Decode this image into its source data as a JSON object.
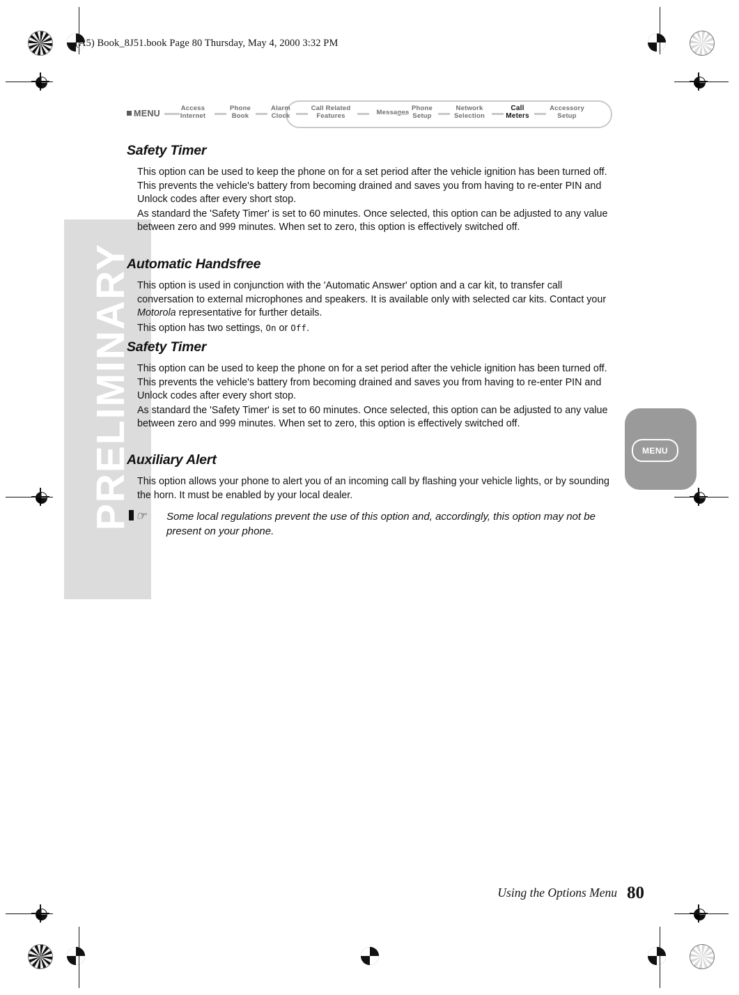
{
  "header": {
    "running_head": "(A5) Book_8J51.book  Page 80  Thursday, May 4, 2000  3:32 PM"
  },
  "watermark": {
    "text": "PRELIMINARY"
  },
  "menubar": {
    "menu_label": "MENU",
    "items": [
      {
        "line1": "Access",
        "line2": "Internet",
        "current": false
      },
      {
        "line1": "Phone",
        "line2": "Book",
        "current": false
      },
      {
        "line1": "Alarm",
        "line2": "Clock",
        "current": false
      },
      {
        "line1": "Call Related",
        "line2": "Features",
        "current": false
      },
      {
        "line1": "Messages",
        "line2": "",
        "current": false
      },
      {
        "line1": "Phone",
        "line2": "Setup",
        "current": false
      },
      {
        "line1": "Network",
        "line2": "Selection",
        "current": false
      },
      {
        "line1": "Call",
        "line2": "Meters",
        "current": true
      },
      {
        "line1": "Accessory",
        "line2": "Setup",
        "current": false
      }
    ]
  },
  "sections": [
    {
      "heading": "Safety Timer",
      "paragraphs": [
        "This option can be used to keep the phone on for a set period after the vehicle ignition has been turned off. This prevents the vehicle's battery from becoming drained and saves you from having to re-enter PIN and Unlock codes after every short stop.",
        "As standard the 'Safety Timer' is set to 60 minutes. Once selected, this option can be adjusted to any value between zero and 999 minutes. When set to zero, this option is effectively switched off."
      ]
    },
    {
      "heading": "Automatic Handsfree",
      "paragraphs": [
        "This option is used in conjunction with the 'Automatic Answer' option and a car kit, to transfer call conversation to external microphones and speakers. It is available only with selected car kits. Contact your Motorola representative for further details.",
        "This option has two settings, On or Off."
      ],
      "italic_word": "Motorola",
      "setting_on": "On",
      "setting_off": "Off"
    },
    {
      "heading": "Safety Timer",
      "paragraphs": [
        "This option can be used to keep the phone on for a set period after the vehicle ignition has been turned off. This prevents the vehicle's battery from becoming drained and saves you from having to re-enter PIN and Unlock codes after every short stop.",
        "As standard the 'Safety Timer' is set to 60 minutes. Once selected, this option can be adjusted to any value between zero and 999 minutes. When set to zero, this option is effectively switched off."
      ]
    },
    {
      "heading": "Auxiliary Alert",
      "paragraphs": [
        "This option allows your phone to alert you of an incoming call by flashing your vehicle lights, or by sounding the horn. It must be enabled by your local dealer."
      ],
      "note": "Some local regulations prevent the use of this option and, accordingly, this option may not be present on your phone."
    }
  ],
  "menu_key": {
    "label": "MENU"
  },
  "footer": {
    "chapter": "Using the Options Menu",
    "page_number": "80"
  }
}
